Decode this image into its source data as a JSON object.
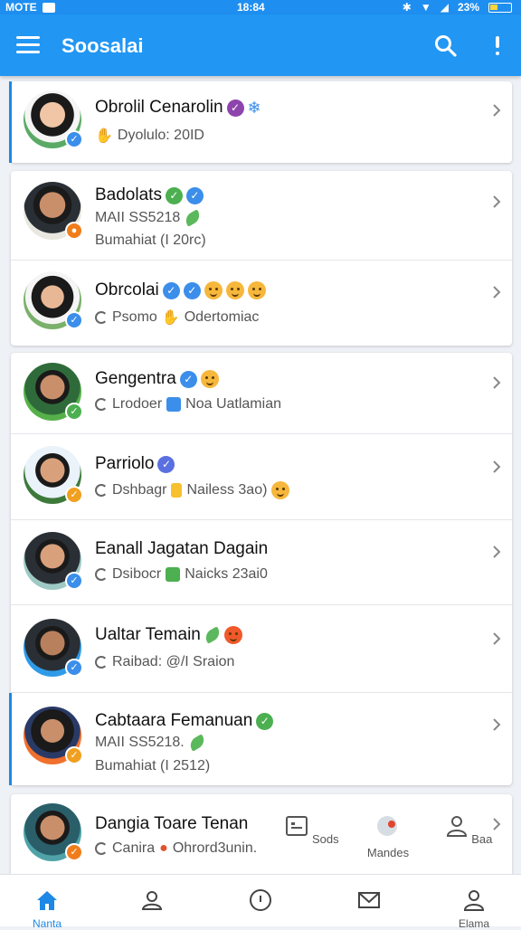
{
  "status_bar": {
    "carrier": "MOTE",
    "time": "18:84",
    "battery": "23%"
  },
  "app_bar": {
    "title": "Soosalai"
  },
  "colors": {
    "primary": "#2196f3",
    "accent": "#1e88e5",
    "verified": "#3b8eea",
    "green": "#4caf50",
    "orange": "#f0a020"
  },
  "contacts": [
    {
      "name": "Obrolil Cenarolin",
      "line1": "Dyolulo: 20ID"
    },
    {
      "name": "Badolats",
      "line1": "MAII SS5218",
      "line2": "Bumahiat (I 20rc)"
    },
    {
      "name": "Obrcolai",
      "line1": "Psomo",
      "line1b": "Odertomiac"
    },
    {
      "name": "Gengentra",
      "line1": "Lrodoer",
      "line1b": "Noa Uatlamian"
    },
    {
      "name": "Parriolo",
      "line1": "Dshbagr",
      "line1b": "Nailess 3ao)"
    },
    {
      "name": "Eanall Jagatan Dagain",
      "line1": "Dsibocr",
      "line1b": "Naicks 23ai0"
    },
    {
      "name": "Ualtar Temain",
      "line1": "Raibad: @/I Sraion"
    },
    {
      "name": "Cabtaara Femanuan",
      "line1": "MAII SS5218.",
      "line2": "Bumahiat (I 2512)"
    },
    {
      "name": "Dangia Toare Tenan",
      "line1": "Canira",
      "line1b": "Ohrord3unin."
    }
  ],
  "quick_actions": [
    {
      "label": "Sods",
      "icon": "card-icon"
    },
    {
      "label": "Mandes",
      "icon": "profile-dot-icon"
    },
    {
      "label": "Baa",
      "icon": "person-icon"
    }
  ],
  "bottom_nav": [
    {
      "label": "Nanta",
      "icon": "home-icon",
      "active": true
    },
    {
      "label": "",
      "icon": "people-icon"
    },
    {
      "label": "",
      "icon": "compass-icon"
    },
    {
      "label": "",
      "icon": "mail-icon"
    },
    {
      "label": "Elama",
      "icon": "account-icon"
    }
  ]
}
